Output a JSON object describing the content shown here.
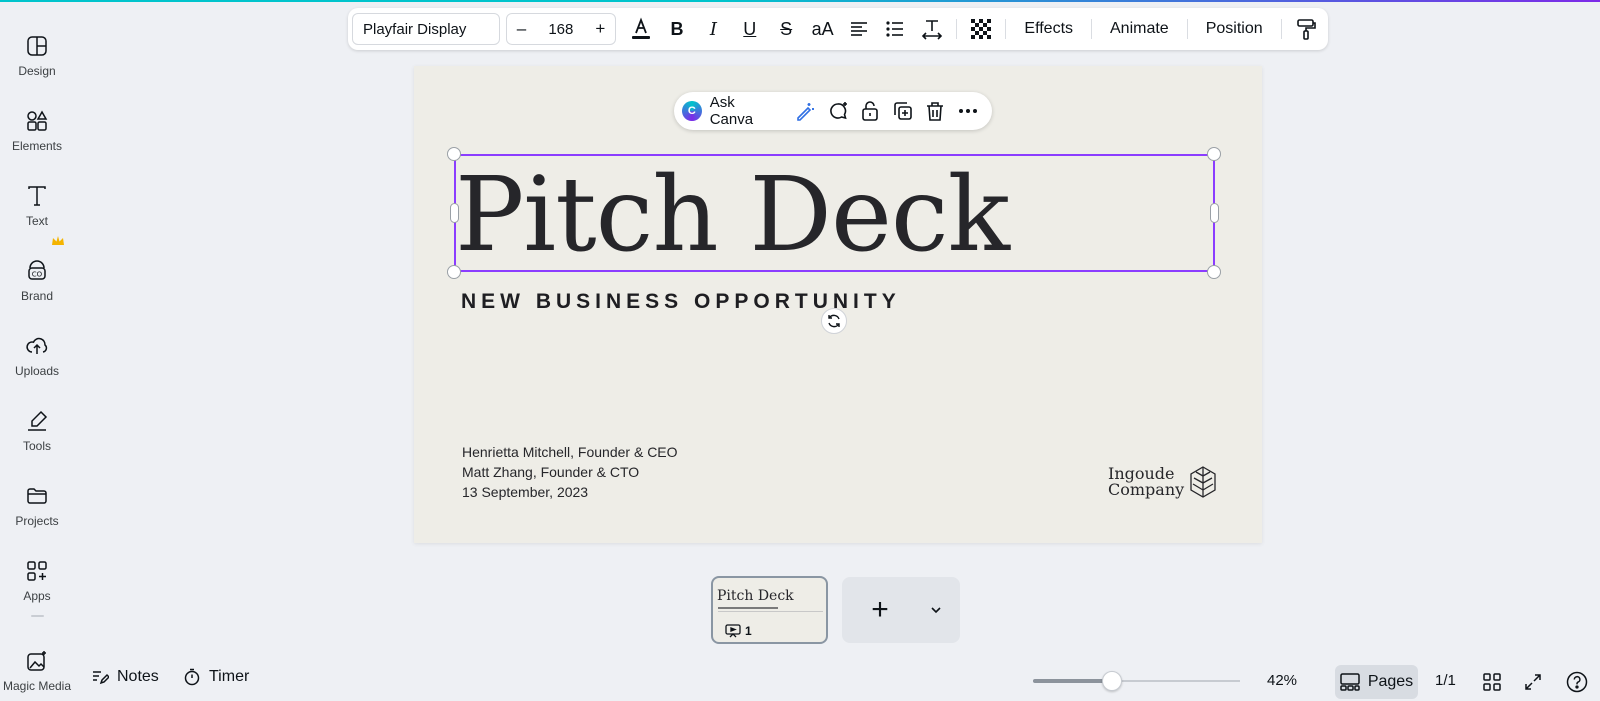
{
  "sidebar": {
    "items": [
      {
        "label": "Design",
        "icon": "design-icon"
      },
      {
        "label": "Elements",
        "icon": "elements-icon"
      },
      {
        "label": "Text",
        "icon": "text-icon"
      },
      {
        "label": "Brand",
        "icon": "brand-icon",
        "badge": "crown-icon"
      },
      {
        "label": "Uploads",
        "icon": "upload-cloud-icon"
      },
      {
        "label": "Tools",
        "icon": "tools-icon"
      },
      {
        "label": "Projects",
        "icon": "folder-icon"
      },
      {
        "label": "Apps",
        "icon": "apps-grid-icon"
      },
      {
        "label": "Magic Media",
        "icon": "magic-media-icon"
      }
    ]
  },
  "toolbar": {
    "font_family": "Playfair Display",
    "font_size": "168",
    "decrease_label": "–",
    "increase_label": "+",
    "effects_label": "Effects",
    "animate_label": "Animate",
    "position_label": "Position",
    "case_label": "aA"
  },
  "ask_canva": {
    "label": "Ask Canva",
    "logo_letter": "C"
  },
  "slide": {
    "title": "Pitch Deck",
    "subtitle": "NEW BUSINESS OPPORTUNITY",
    "presenter_1": "Henrietta Mitchell, Founder & CEO",
    "presenter_2": "Matt Zhang, Founder & CTO",
    "date": "13 September, 2023",
    "logo_line_1": "Ingoude",
    "logo_line_2": "Company"
  },
  "thumbnail": {
    "title": "Pitch Deck",
    "page_number": "1"
  },
  "bottom_bar": {
    "notes_label": "Notes",
    "timer_label": "Timer",
    "zoom": "42%",
    "zoom_fraction": 0.38,
    "pages_label": "Pages",
    "page_count": "1/1"
  },
  "colors": {
    "accent": "#8b3dff",
    "page_background": "#eeede7",
    "brand_teal": "#00c4cc"
  }
}
